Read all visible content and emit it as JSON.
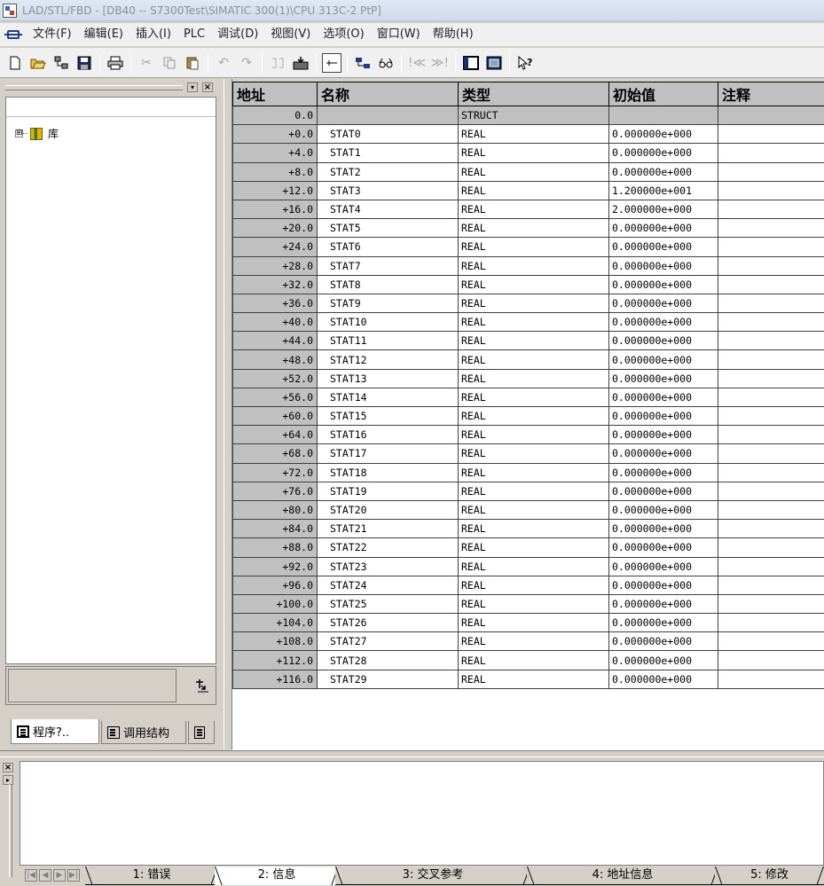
{
  "window": {
    "title": "LAD/STL/FBD  - [DB40 -- S7300Test\\SIMATIC 300(1)\\CPU 313C-2 PtP]"
  },
  "menu": {
    "items": [
      "文件(F)",
      "编辑(E)",
      "插入(I)",
      "PLC",
      "调试(D)",
      "视图(V)",
      "选项(O)",
      "窗口(W)",
      "帮助(H)"
    ]
  },
  "toolbar": {
    "icons": [
      "new-icon",
      "open-icon",
      "network-icon",
      "save-icon",
      "print-icon",
      "cut-icon",
      "copy-icon",
      "paste-icon",
      "undo-icon",
      "redo-icon",
      "compile-icon",
      "download-icon",
      "monitor-icon",
      "online-icon",
      "glasses-icon",
      "prev-error-icon",
      "next-error-icon",
      "overview-icon",
      "view-icon",
      "help-icon"
    ]
  },
  "tree": {
    "expander": "⊞",
    "library_label": "库"
  },
  "left_tabs": {
    "program": "程序?..",
    "call_structure": "调用结构"
  },
  "table": {
    "headers": {
      "address": "地址",
      "name": "名称",
      "type": "类型",
      "initial": "初始值",
      "comment": "注释"
    },
    "rows": [
      {
        "address": "0.0",
        "name": "",
        "type": "STRUCT",
        "initial": "",
        "comment": ""
      },
      {
        "address": "+0.0",
        "name": "STAT0",
        "type": "REAL",
        "initial": "0.000000e+000",
        "comment": ""
      },
      {
        "address": "+4.0",
        "name": "STAT1",
        "type": "REAL",
        "initial": "0.000000e+000",
        "comment": ""
      },
      {
        "address": "+8.0",
        "name": "STAT2",
        "type": "REAL",
        "initial": "0.000000e+000",
        "comment": ""
      },
      {
        "address": "+12.0",
        "name": "STAT3",
        "type": "REAL",
        "initial": "1.200000e+001",
        "comment": ""
      },
      {
        "address": "+16.0",
        "name": "STAT4",
        "type": "REAL",
        "initial": "2.000000e+000",
        "comment": ""
      },
      {
        "address": "+20.0",
        "name": "STAT5",
        "type": "REAL",
        "initial": "0.000000e+000",
        "comment": ""
      },
      {
        "address": "+24.0",
        "name": "STAT6",
        "type": "REAL",
        "initial": "0.000000e+000",
        "comment": ""
      },
      {
        "address": "+28.0",
        "name": "STAT7",
        "type": "REAL",
        "initial": "0.000000e+000",
        "comment": ""
      },
      {
        "address": "+32.0",
        "name": "STAT8",
        "type": "REAL",
        "initial": "0.000000e+000",
        "comment": ""
      },
      {
        "address": "+36.0",
        "name": "STAT9",
        "type": "REAL",
        "initial": "0.000000e+000",
        "comment": ""
      },
      {
        "address": "+40.0",
        "name": "STAT10",
        "type": "REAL",
        "initial": "0.000000e+000",
        "comment": ""
      },
      {
        "address": "+44.0",
        "name": "STAT11",
        "type": "REAL",
        "initial": "0.000000e+000",
        "comment": ""
      },
      {
        "address": "+48.0",
        "name": "STAT12",
        "type": "REAL",
        "initial": "0.000000e+000",
        "comment": ""
      },
      {
        "address": "+52.0",
        "name": "STAT13",
        "type": "REAL",
        "initial": "0.000000e+000",
        "comment": ""
      },
      {
        "address": "+56.0",
        "name": "STAT14",
        "type": "REAL",
        "initial": "0.000000e+000",
        "comment": ""
      },
      {
        "address": "+60.0",
        "name": "STAT15",
        "type": "REAL",
        "initial": "0.000000e+000",
        "comment": ""
      },
      {
        "address": "+64.0",
        "name": "STAT16",
        "type": "REAL",
        "initial": "0.000000e+000",
        "comment": ""
      },
      {
        "address": "+68.0",
        "name": "STAT17",
        "type": "REAL",
        "initial": "0.000000e+000",
        "comment": ""
      },
      {
        "address": "+72.0",
        "name": "STAT18",
        "type": "REAL",
        "initial": "0.000000e+000",
        "comment": ""
      },
      {
        "address": "+76.0",
        "name": "STAT19",
        "type": "REAL",
        "initial": "0.000000e+000",
        "comment": ""
      },
      {
        "address": "+80.0",
        "name": "STAT20",
        "type": "REAL",
        "initial": "0.000000e+000",
        "comment": ""
      },
      {
        "address": "+84.0",
        "name": "STAT21",
        "type": "REAL",
        "initial": "0.000000e+000",
        "comment": ""
      },
      {
        "address": "+88.0",
        "name": "STAT22",
        "type": "REAL",
        "initial": "0.000000e+000",
        "comment": ""
      },
      {
        "address": "+92.0",
        "name": "STAT23",
        "type": "REAL",
        "initial": "0.000000e+000",
        "comment": ""
      },
      {
        "address": "+96.0",
        "name": "STAT24",
        "type": "REAL",
        "initial": "0.000000e+000",
        "comment": ""
      },
      {
        "address": "+100.0",
        "name": "STAT25",
        "type": "REAL",
        "initial": "0.000000e+000",
        "comment": ""
      },
      {
        "address": "+104.0",
        "name": "STAT26",
        "type": "REAL",
        "initial": "0.000000e+000",
        "comment": ""
      },
      {
        "address": "+108.0",
        "name": "STAT27",
        "type": "REAL",
        "initial": "0.000000e+000",
        "comment": ""
      },
      {
        "address": "+112.0",
        "name": "STAT28",
        "type": "REAL",
        "initial": "0.000000e+000",
        "comment": ""
      },
      {
        "address": "+116.0",
        "name": "STAT29",
        "type": "REAL",
        "initial": "0.000000e+000",
        "comment": ""
      }
    ]
  },
  "bottom_tabs": {
    "items": [
      "1: 错误",
      "2: 信息",
      "3: 交叉参考",
      "4: 地址信息",
      "5: 修改"
    ],
    "active_index": 1
  },
  "colors": {
    "header_gray": "#c0c0c0",
    "panel_gray": "#d4d0c8",
    "title_text": "#8a8f99"
  }
}
